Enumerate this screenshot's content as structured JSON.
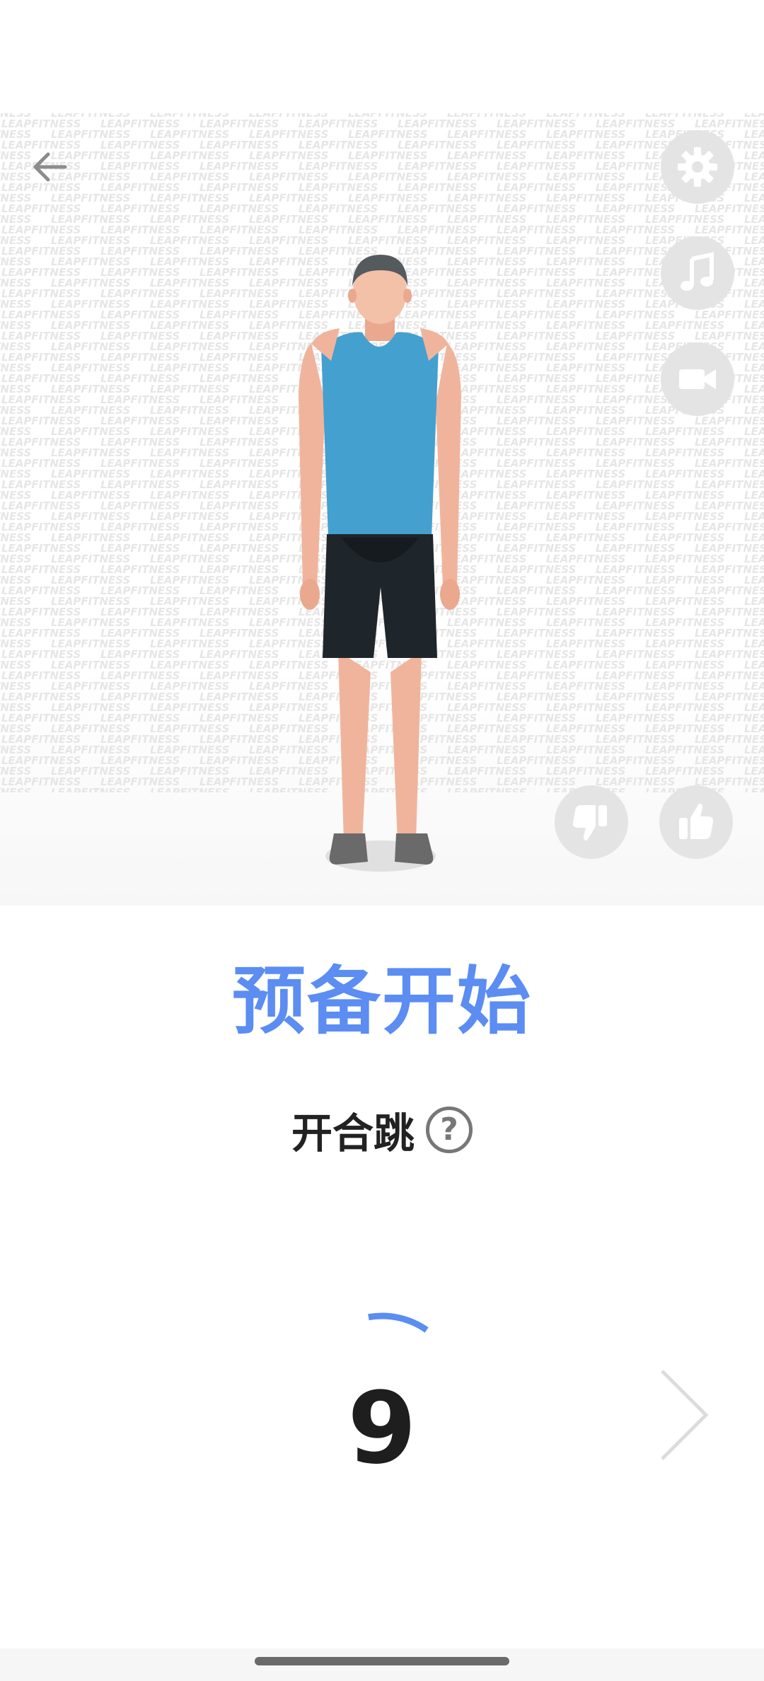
{
  "header": {
    "back_icon": "arrow-left-icon"
  },
  "illustration": {
    "watermark_text": "LEAPFITNESS"
  },
  "side_buttons": [
    {
      "icon": "gear-icon"
    },
    {
      "icon": "music-note-icon"
    },
    {
      "icon": "video-camera-icon"
    }
  ],
  "feedback": {
    "dislike_icon": "thumbs-down-icon",
    "like_icon": "thumbs-up-icon"
  },
  "main": {
    "title": "预备开始",
    "exercise_name": "开合跳",
    "help_symbol": "?",
    "countdown": "9",
    "next_icon": "chevron-right-icon"
  },
  "colors": {
    "accent": "#5b8df2",
    "fab_bg": "#e4e4e4",
    "text_dark": "#1e1e1e"
  }
}
